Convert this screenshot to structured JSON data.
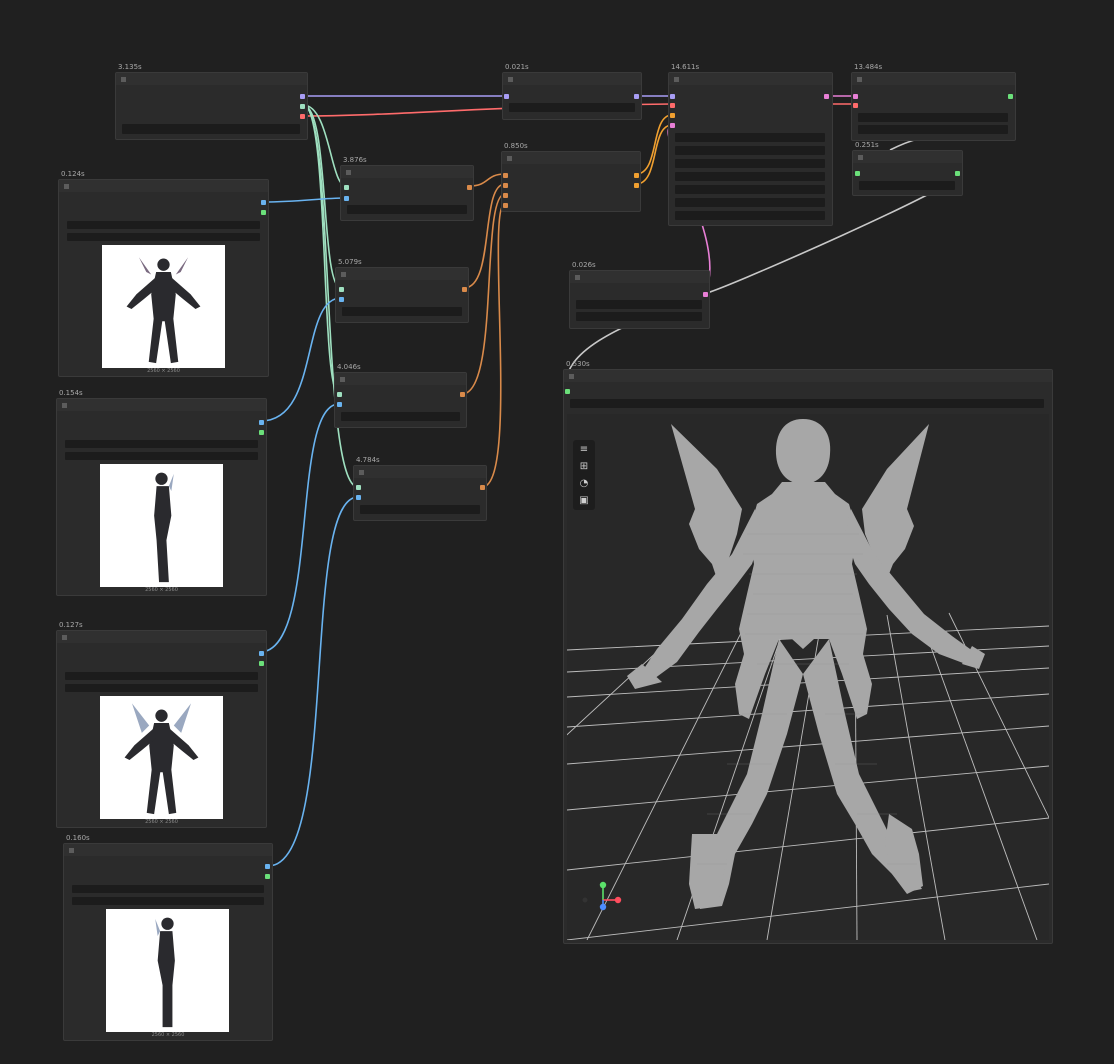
{
  "canvas": {
    "background": "#202020"
  },
  "wire_colors": {
    "purple": "#a89df5",
    "red": "#ff6b6b",
    "mint": "#9fe0c0",
    "blue": "#69b3f0",
    "orange": "#d98a4a",
    "amber": "#f0a030",
    "pink": "#e87fd6",
    "gray": "#c8c8c8"
  },
  "nodes": [
    {
      "id": "loader",
      "badge": "3.135s"
    },
    {
      "id": "combine-a",
      "badge": "0.021s"
    },
    {
      "id": "combine-b",
      "badge": "0.850s"
    },
    {
      "id": "main",
      "badge": "14.611s"
    },
    {
      "id": "export",
      "badge": "13.484s"
    },
    {
      "id": "small",
      "badge": "0.251s"
    },
    {
      "id": "enc-1",
      "badge": "3.876s"
    },
    {
      "id": "enc-2",
      "badge": "5.079s"
    },
    {
      "id": "enc-3",
      "badge": "4.046s"
    },
    {
      "id": "enc-4",
      "badge": "4.784s"
    },
    {
      "id": "decode",
      "badge": "0.026s"
    },
    {
      "id": "preview3d",
      "badge": "0.530s"
    },
    {
      "id": "img-front",
      "badge": "0.124s",
      "caption": "2560 × 2560"
    },
    {
      "id": "img-left",
      "badge": "0.154s",
      "caption": "2560 × 2560"
    },
    {
      "id": "img-back",
      "badge": "0.127s",
      "caption": "2560 × 2560"
    },
    {
      "id": "img-right",
      "badge": "0.160s",
      "caption": "2560 × 2560"
    }
  ],
  "viewer": {
    "toolbar": [
      "menu-icon",
      "grid-icon",
      "camera-orbit-icon",
      "image-icon"
    ],
    "gizmo_colors": {
      "x": "#ff4d5e",
      "y": "#5be06a",
      "z": "#4d8dff"
    }
  }
}
